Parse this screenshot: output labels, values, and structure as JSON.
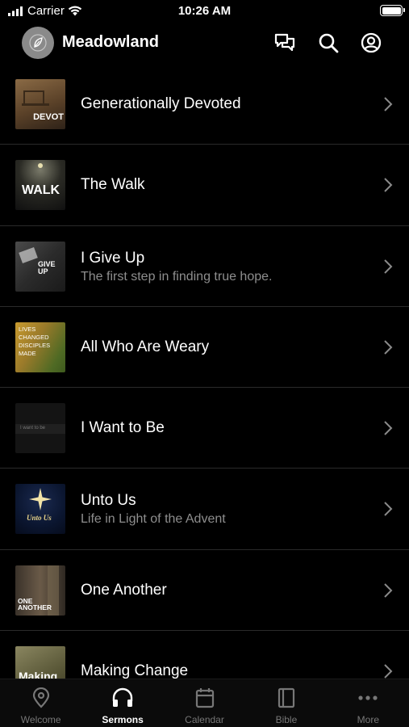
{
  "status": {
    "carrier": "Carrier",
    "time": "10:26 AM"
  },
  "header": {
    "title": "Meadowland"
  },
  "sermons": [
    {
      "title": "Generationally Devoted",
      "subtitle": "",
      "thumb_text": "DEVOT",
      "thumb_bg": "#6b5034"
    },
    {
      "title": "The Walk",
      "subtitle": "",
      "thumb_text": "WALK",
      "thumb_bg": "#1d1d1d"
    },
    {
      "title": "I Give Up",
      "subtitle": "The first step in finding true hope.",
      "thumb_text": "GIVE UP",
      "thumb_bg": "#3b3b3b"
    },
    {
      "title": "All Who Are Weary",
      "subtitle": "",
      "thumb_text": "LIVES CHANGED DISCIPLES MADE",
      "thumb_bg": "#b28a2a"
    },
    {
      "title": "I Want to Be",
      "subtitle": "",
      "thumb_text": "I want to be",
      "thumb_bg": "#141414"
    },
    {
      "title": "Unto Us",
      "subtitle": "Life in Light of the Advent",
      "thumb_text": "Unto Us",
      "thumb_bg": "#0b1630"
    },
    {
      "title": "One Another",
      "subtitle": "",
      "thumb_text": "ONE ANOTHER",
      "thumb_bg": "#4a4036"
    },
    {
      "title": "Making Change",
      "subtitle": "",
      "thumb_text": "Making",
      "thumb_bg": "#6c6a48"
    }
  ],
  "tabs": [
    {
      "label": "Welcome",
      "icon": "location-pin-icon"
    },
    {
      "label": "Sermons",
      "icon": "headphones-icon"
    },
    {
      "label": "Calendar",
      "icon": "calendar-icon"
    },
    {
      "label": "Bible",
      "icon": "book-icon"
    },
    {
      "label": "More",
      "icon": "more-dots-icon"
    }
  ],
  "active_tab": "Sermons",
  "colors": {
    "background": "#000000",
    "secondary_text": "#8e8e8e",
    "divider": "#2a2a2a",
    "inactive_tab": "#777777"
  }
}
